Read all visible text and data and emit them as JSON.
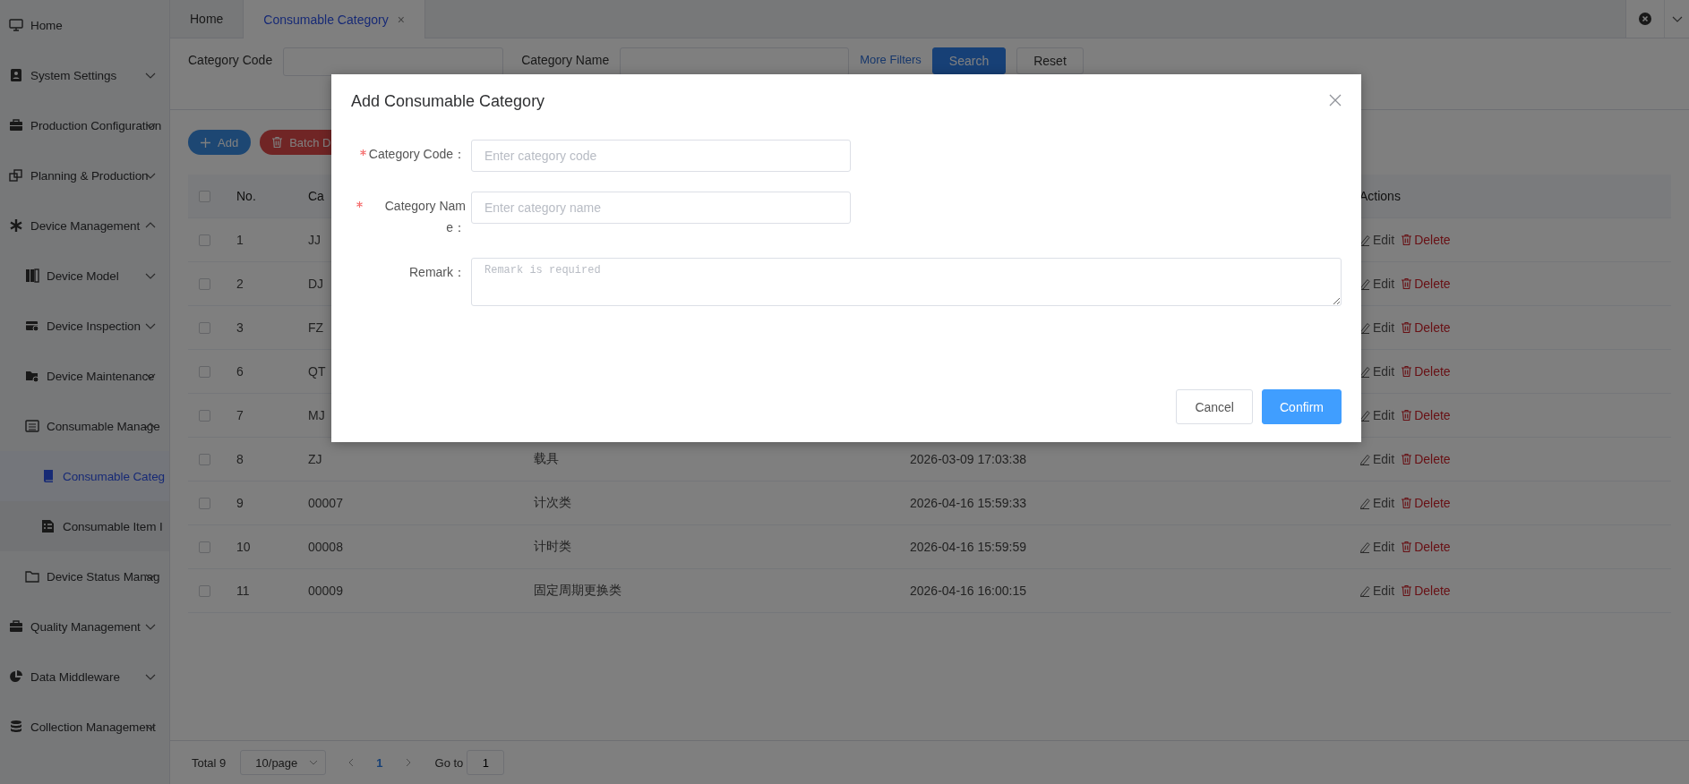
{
  "sidebar": {
    "items": [
      {
        "label": "Home",
        "selected": false
      },
      {
        "label": "System Settings",
        "selected": false,
        "expanded": false
      },
      {
        "label": "Production Configuration",
        "selected": false,
        "expanded": false
      },
      {
        "label": "Planning & Production",
        "selected": false,
        "expanded": false
      },
      {
        "label": "Device Management",
        "selected": false,
        "expanded": true,
        "children": [
          {
            "label": "Device Model",
            "selected": false,
            "expanded": false
          },
          {
            "label": "Device Inspection",
            "selected": false,
            "expanded": false
          },
          {
            "label": "Device Maintenance",
            "selected": false,
            "expanded": false
          },
          {
            "label": "Consumable Manage",
            "selected": false,
            "expanded": true,
            "children": [
              {
                "label": "Consumable Categ",
                "selected": true
              },
              {
                "label": "Consumable Item I",
                "selected": false
              }
            ]
          },
          {
            "label": "Device Status Manag",
            "selected": false,
            "expanded": false
          }
        ]
      },
      {
        "label": "Quality Management",
        "selected": false,
        "expanded": false
      },
      {
        "label": "Data Middleware",
        "selected": false,
        "expanded": false
      },
      {
        "label": "Collection Management",
        "selected": false,
        "expanded": false
      }
    ]
  },
  "tabs": [
    {
      "label": "Home",
      "selected": false
    },
    {
      "label": "Consumable Category",
      "selected": true,
      "close": "×"
    }
  ],
  "filters": {
    "code_label": "Category Code",
    "name_label": "Category Name",
    "more_filters": "More Filters",
    "search": "Search",
    "reset": "Reset"
  },
  "toolbar": {
    "add": "Add",
    "batch_delete": "Batch D"
  },
  "table": {
    "header": {
      "checked": false,
      "no": "No.",
      "code": "Ca",
      "actions": "Actions"
    },
    "rows": [
      {
        "checked": false,
        "no": "1",
        "code": "JJ",
        "edit": "Edit",
        "delete": "Delete"
      },
      {
        "checked": false,
        "no": "2",
        "code": "DJ",
        "edit": "Edit",
        "delete": "Delete"
      },
      {
        "checked": false,
        "no": "3",
        "code": "FZ",
        "edit": "Edit",
        "delete": "Delete"
      },
      {
        "checked": false,
        "no": "6",
        "code": "QT",
        "edit": "Edit",
        "delete": "Delete"
      },
      {
        "checked": false,
        "no": "7",
        "code": "MJ",
        "edit": "Edit",
        "delete": "Delete"
      },
      {
        "checked": false,
        "no": "8",
        "code": "ZJ",
        "name": "载具",
        "created": "2026-03-09 17:03:38",
        "edit": "Edit",
        "delete": "Delete"
      },
      {
        "checked": false,
        "no": "9",
        "code": "00007",
        "name": "计次类",
        "created": "2026-04-16 15:59:33",
        "edit": "Edit",
        "delete": "Delete"
      },
      {
        "checked": false,
        "no": "10",
        "code": "00008",
        "name": "计时类",
        "created": "2026-04-16 15:59:59",
        "edit": "Edit",
        "delete": "Delete"
      },
      {
        "checked": false,
        "no": "11",
        "code": "00009",
        "name": "固定周期更换类",
        "created": "2026-04-16 16:00:15",
        "edit": "Edit",
        "delete": "Delete"
      }
    ]
  },
  "pagination": {
    "total": "Total 9",
    "page_size": "10/page",
    "pages": [
      {
        "label": "1",
        "selected": true
      }
    ],
    "goto_label": "Go to",
    "goto_value": "1"
  },
  "dialog": {
    "title": "Add Consumable Category",
    "fields": [
      {
        "kind": "input",
        "label": "Category Code：",
        "required": true,
        "placeholder": "Enter category code"
      },
      {
        "kind": "input",
        "label": "Category Name：",
        "required": true,
        "placeholder": "Enter category name"
      },
      {
        "kind": "textarea",
        "label": "Remark：",
        "required": false,
        "placeholder": "Remark is required"
      }
    ],
    "buttons": [
      {
        "label": "Cancel",
        "primary": false
      },
      {
        "label": "Confirm",
        "primary": true
      }
    ]
  }
}
